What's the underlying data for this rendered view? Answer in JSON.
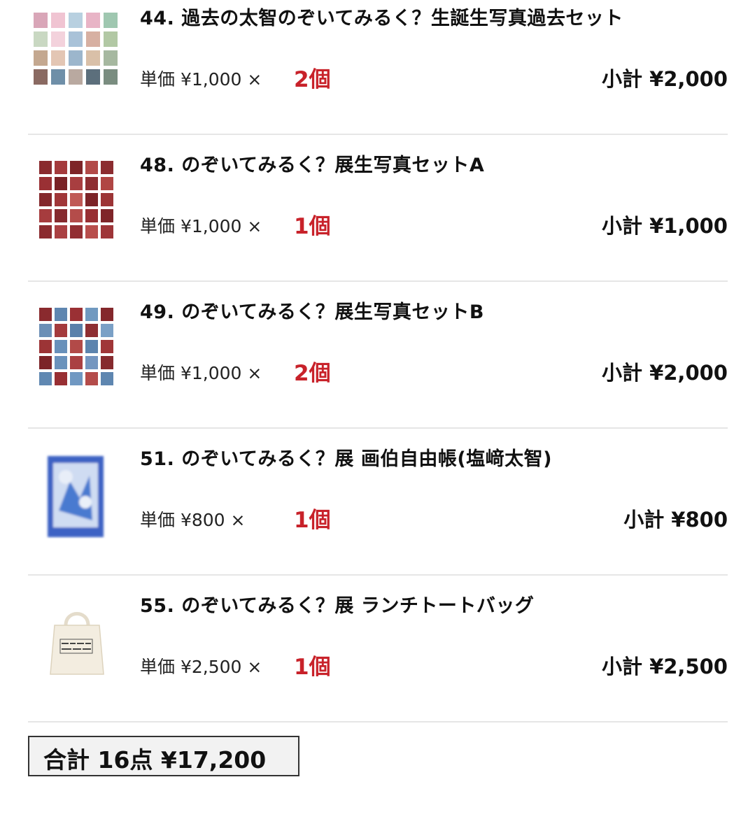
{
  "items": [
    {
      "name": "44. 過去の太智のぞいてみるく？生誕生写真過去セット",
      "price": "単価 ¥1,000 ×",
      "qty": "2個",
      "subtotal": "小計 ¥2,000",
      "thumb": "photo-grid-pastel-icon"
    },
    {
      "name": "48. のぞいてみるく？展生写真セットA",
      "price": "単価 ¥1,000 ×",
      "qty": "1個",
      "subtotal": "小計 ¥1,000",
      "thumb": "photo-grid-red-icon"
    },
    {
      "name": "49. のぞいてみるく？展生写真セットB",
      "price": "単価 ¥1,000 ×",
      "qty": "2個",
      "subtotal": "小計 ¥2,000",
      "thumb": "photo-grid-mixed-icon"
    },
    {
      "name": "51. のぞいてみるく？展 画伯自由帳(塩﨑太智)",
      "price": "単価 ¥800 ×",
      "qty": "1個",
      "subtotal": "小計 ¥800",
      "thumb": "notebook-icon"
    },
    {
      "name": "55. のぞいてみるく？展 ランチトートバッグ",
      "price": "単価 ¥2,500 ×",
      "qty": "1個",
      "subtotal": "小計 ¥2,500",
      "thumb": "tote-bag-icon"
    }
  ],
  "total": {
    "label": "合計 16点 ¥17,200"
  },
  "colors": {
    "quantity": "#c8222a",
    "divider": "#e6e6e6",
    "total_border": "#333333"
  }
}
